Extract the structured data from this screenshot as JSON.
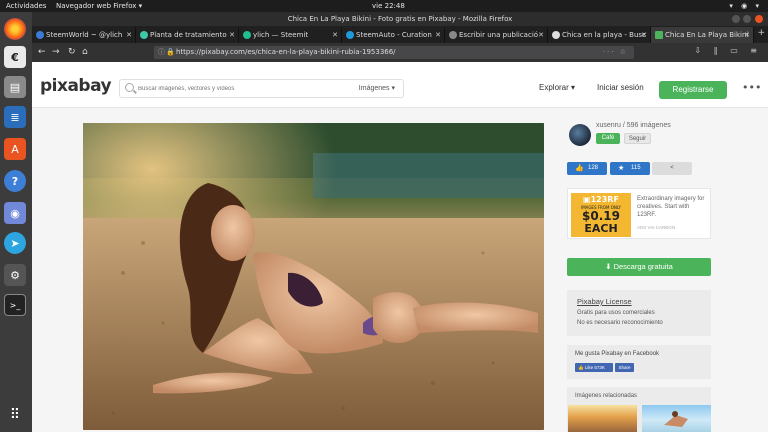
{
  "os_topbar": {
    "activities": "Actividades",
    "app_menu": "Navegador web Firefox ▾",
    "clock": "vie 22:48",
    "tray": "▾ ◉ ▾"
  },
  "window": {
    "title": "Chica En La Playa Bikini - Foto gratis en Pixabay - Mozilla Firefox"
  },
  "tabs": [
    {
      "label": "SteemWorld ~ @ylich",
      "color": "#3b7bd6"
    },
    {
      "label": "Planta de tratamiento",
      "color": "#3fc8a8"
    },
    {
      "label": "ylich — Steemit",
      "color": "#1fbf8f"
    },
    {
      "label": "SteemAuto - Curation",
      "color": "#1e9bd7"
    },
    {
      "label": "Escribir una publicació",
      "color": "#888888"
    },
    {
      "label": "Chica en la playa - Busc",
      "color": "#dddddd"
    },
    {
      "label": "Chica En La Playa Bikini",
      "color": "#4bb35a"
    }
  ],
  "url": "https://pixabay.com/es/chica-en-la-playa-bikini-rubia-1953366/",
  "header": {
    "logo": "pixabay",
    "search_placeholder": "Buscar imágenes, vectores y vídeos",
    "search_type": "Imágenes ▾",
    "explore": "Explorar ▾",
    "login": "Iniciar sesión",
    "signup": "Registrarse",
    "more": "•••"
  },
  "uploader": {
    "name": "xusenru / 596 imágenes",
    "cafe": "Café",
    "follow": "Seguir"
  },
  "actions": {
    "likes": "128",
    "favorites": "115"
  },
  "ad": {
    "brand": "▣123RF",
    "tag": "IMAGES FROM ONLY",
    "price": "$0.19",
    "each": "EACH",
    "text": "Extraordinary imagery for creatives. Start with 123RF.",
    "via": "ADS VIA CARBON"
  },
  "download_label": "⬇ Descarga gratuita",
  "license": {
    "title": "Pixabay License",
    "line1": "Gratis para usos comerciales",
    "line2": "No es necesario reconocimiento"
  },
  "facebook": {
    "text": "Me gusta Pixabay en Facebook",
    "like": "👍 Like 573K",
    "share": "Share"
  },
  "related_title": "Imágenes relacionadas",
  "colors": {
    "accent_green": "#4bb35a",
    "like_blue": "#2f76c9"
  }
}
